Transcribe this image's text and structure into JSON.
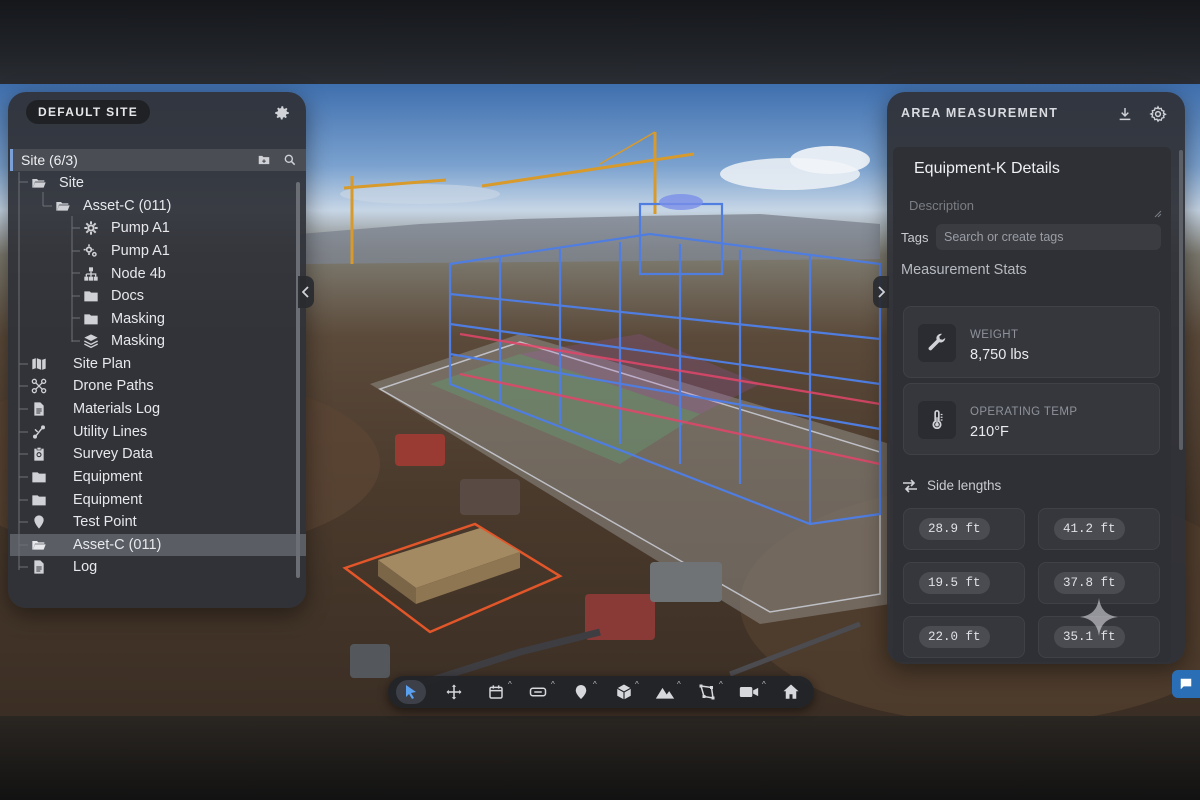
{
  "left_panel": {
    "site_name": "DEFAULT SITE",
    "tree_header": "Site (6/3)",
    "items": [
      {
        "label": "Site",
        "icon": "folder-open-icon"
      },
      {
        "label": "Asset-C (011)",
        "icon": "folder-open-icon"
      },
      {
        "label": "Pump A1",
        "icon": "gear-icon"
      },
      {
        "label": "Pump A1",
        "icon": "gears-icon"
      },
      {
        "label": "Node 4b",
        "icon": "hierarchy-icon"
      },
      {
        "label": "Docs",
        "icon": "folder-icon"
      },
      {
        "label": "Masking",
        "icon": "folder-icon"
      },
      {
        "label": "Masking",
        "icon": "layers-icon"
      },
      {
        "label": "Site Plan",
        "icon": "map-icon"
      },
      {
        "label": "Drone Paths",
        "icon": "drone-icon"
      },
      {
        "label": "Materials Log",
        "icon": "document-icon"
      },
      {
        "label": "Utility Lines",
        "icon": "route-icon"
      },
      {
        "label": "Survey Data",
        "icon": "clipboard-icon"
      },
      {
        "label": "Equipment",
        "icon": "folder-icon"
      },
      {
        "label": "Equipment",
        "icon": "folder-icon"
      },
      {
        "label": "Test Point",
        "icon": "pin-icon"
      },
      {
        "label": "Asset-C (011)",
        "icon": "folder-open-icon",
        "selected": true
      },
      {
        "label": "Log",
        "icon": "document-icon"
      }
    ]
  },
  "right_panel": {
    "title": "AREA MEASUREMENT",
    "details_title": "Equipment-K Details",
    "description_placeholder": "Description",
    "tags_label": "Tags",
    "tags_placeholder": "Search or create tags",
    "stats_title": "Measurement Stats",
    "stats": [
      {
        "label": "WEIGHT",
        "value": "8,750 lbs",
        "icon": "wrench-icon"
      },
      {
        "label": "OPERATING TEMP",
        "value": "210°F",
        "icon": "thermometer-icon"
      }
    ],
    "side_lengths_title": "Side lengths",
    "side_lengths": [
      "28.9 ft",
      "41.2 ft",
      "19.5 ft",
      "37.8 ft",
      "22.0 ft",
      "35.1 ft"
    ]
  },
  "toolbar": {
    "tools": [
      {
        "name": "select-tool",
        "icon": "cursor-icon",
        "active": true
      },
      {
        "name": "move-tool",
        "icon": "move-icon"
      },
      {
        "name": "calendar-tool",
        "icon": "calendar-icon"
      },
      {
        "name": "measure-tool",
        "icon": "ruler-icon"
      },
      {
        "name": "pin-tool",
        "icon": "pin-icon"
      },
      {
        "name": "cube-tool",
        "icon": "cube-icon"
      },
      {
        "name": "terrain-tool",
        "icon": "mountain-icon"
      },
      {
        "name": "area-tool",
        "icon": "polygon-icon"
      },
      {
        "name": "camera-tool",
        "icon": "video-camera-icon"
      },
      {
        "name": "home-tool",
        "icon": "home-icon"
      }
    ]
  },
  "colors": {
    "accent": "#7aa0d8",
    "panel": "#303238",
    "wireframe": "#4f7de0",
    "highlight": "#e2562a"
  }
}
